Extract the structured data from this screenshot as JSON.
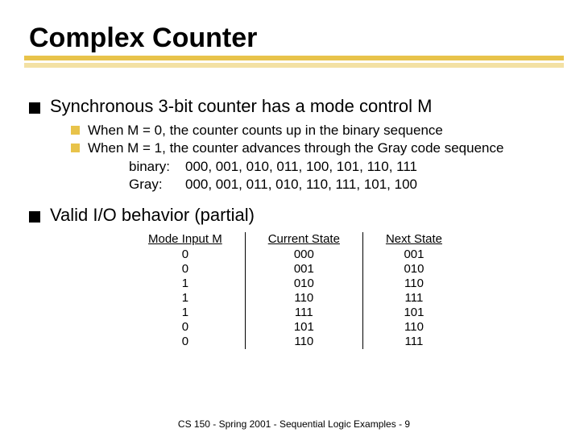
{
  "title": "Complex Counter",
  "bullet1": "Synchronous 3-bit counter has a mode control M",
  "sub1": "When M = 0, the counter counts up in the binary sequence",
  "sub2": "When M = 1, the counter advances through the Gray code sequence",
  "seq_binary_label": "binary:",
  "seq_binary": "000, 001, 010, 011, 100, 101, 110, 111",
  "seq_gray_label": "Gray:",
  "seq_gray": "000, 001, 011, 010, 110, 111, 101, 100",
  "bullet2": "Valid I/O behavior (partial)",
  "table": {
    "headers": [
      "Mode Input M",
      "Current State",
      "Next State"
    ],
    "rows": [
      [
        "0",
        "000",
        "001"
      ],
      [
        "0",
        "001",
        "010"
      ],
      [
        "1",
        "010",
        "110"
      ],
      [
        "1",
        "110",
        "111"
      ],
      [
        "1",
        "111",
        "101"
      ],
      [
        "0",
        "101",
        "110"
      ],
      [
        "0",
        "110",
        "111"
      ]
    ]
  },
  "footer": "CS 150 - Spring 2001 - Sequential Logic Examples - 9"
}
